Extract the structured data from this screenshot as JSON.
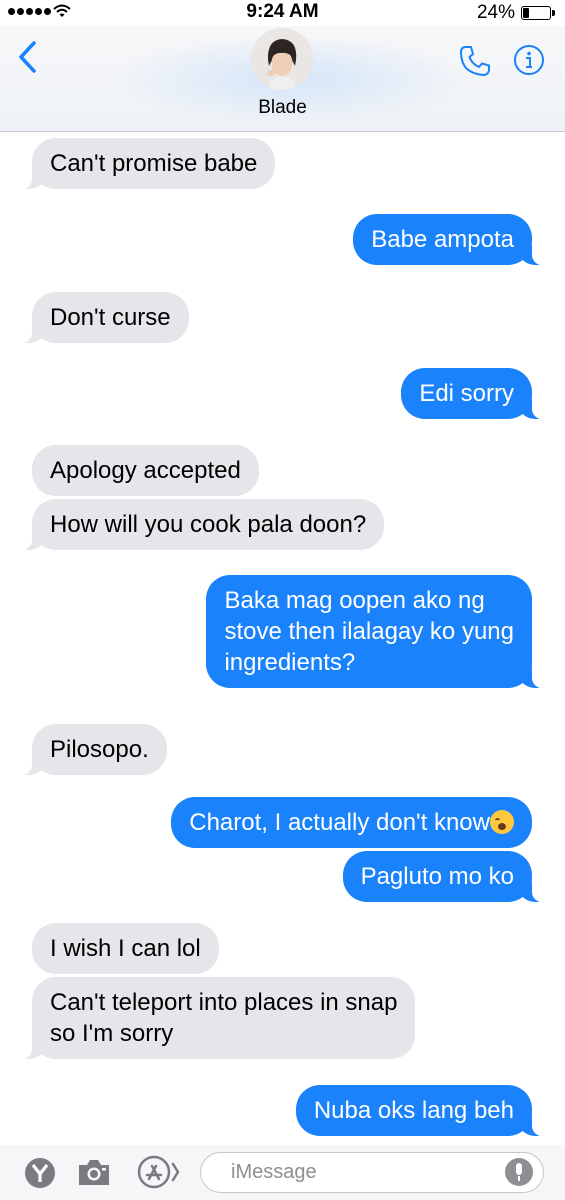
{
  "status_bar": {
    "time": "9:24 AM",
    "battery": "24%",
    "battery_level": 0.24
  },
  "header": {
    "contact_name": "Blade"
  },
  "messages": [
    {
      "from": "them",
      "text": "Can't promise babe"
    },
    {
      "from": "me",
      "text": "Babe ampota"
    },
    {
      "from": "them",
      "text": "Don't curse"
    },
    {
      "from": "me",
      "text": "Edi sorry"
    },
    {
      "from": "them",
      "text": "Apology accepted"
    },
    {
      "from": "them",
      "text": "How will you cook pala doon?"
    },
    {
      "from": "me",
      "lines": [
        "Baka mag oopen ako ng",
        "stove then ilalagay ko yung",
        "ingredients?"
      ]
    },
    {
      "from": "them",
      "text": "Pilosopo."
    },
    {
      "from": "me",
      "text": "Charot, I actually don't know"
    },
    {
      "from": "me",
      "text": "Pagluto mo ko"
    },
    {
      "from": "them",
      "text": "I wish I can lol"
    },
    {
      "from": "them",
      "lines": [
        "Can't teleport into places in snap",
        "so I'm sorry"
      ]
    },
    {
      "from": "me",
      "text": "Nuba oks lang beh"
    }
  ],
  "input_bar": {
    "placeholder": "iMessage"
  },
  "icons": {
    "back": "chevron-left-icon",
    "phone": "phone-icon",
    "info": "info-icon",
    "apps": [
      "yelp-icon",
      "camera-icon",
      "app-store-icon"
    ],
    "mic": "microphone-icon"
  },
  "colors": {
    "outgoing": "#1a82fb",
    "incoming": "#e5e5ea",
    "accent": "#1a82fb"
  }
}
